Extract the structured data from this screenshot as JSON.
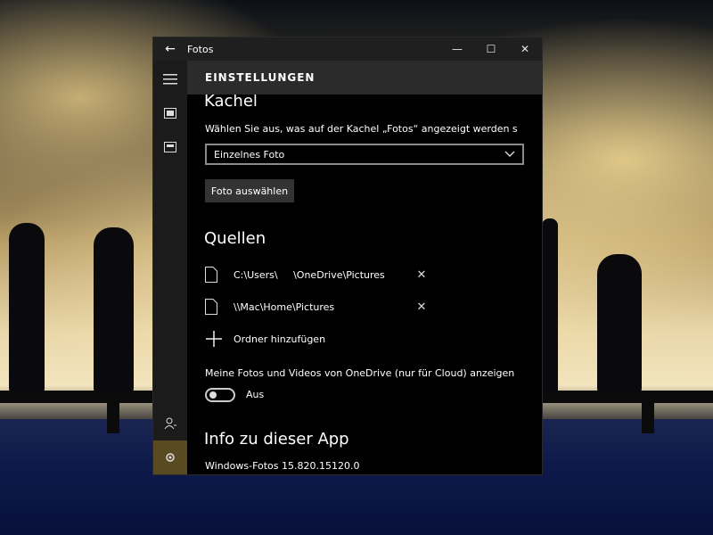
{
  "window": {
    "app_title": "Fotos",
    "controls": {
      "back": "←",
      "minimize": "—",
      "maximize": "☐",
      "close": "✕"
    }
  },
  "header": {
    "title": "EINSTELLUNGEN"
  },
  "rail": {
    "icons": [
      "hamburger-menu-icon",
      "collection-icon",
      "album-icon",
      "person-icon",
      "gear-icon"
    ],
    "active_item": "gear-icon"
  },
  "kachel": {
    "heading": "Kachel",
    "description": "Wählen Sie aus, was auf der Kachel „Fotos“ angezeigt werden s",
    "select_value": "Einzelnes Foto",
    "select_button": "Foto auswählen"
  },
  "quellen": {
    "heading": "Quellen",
    "folders": [
      {
        "path": "C:\\Users\\     \\OneDrive\\Pictures",
        "remove": "✕"
      },
      {
        "path": "\\\\Mac\\Home\\Pictures",
        "remove": "✕"
      }
    ],
    "add_folder": "Ordner hinzufügen",
    "onedrive_label": "Meine Fotos und Videos von OneDrive (nur für Cloud) anzeigen",
    "toggle_state": "Aus"
  },
  "info": {
    "heading": "Info zu dieser App",
    "version": "Windows-Fotos 15.820.15120.0"
  },
  "colors": {
    "accent": "#5a4a22",
    "window_bg": "#000000",
    "titlebar_bg": "#1f1f1f",
    "header_bg": "#2b2b2b"
  }
}
